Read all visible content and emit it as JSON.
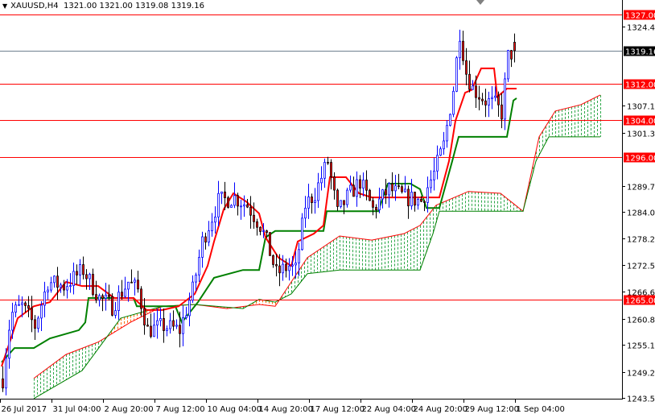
{
  "header": {
    "symbol": "XAUUSD,H4",
    "open": "1321.00",
    "high": "1321.00",
    "low": "1319.08",
    "close": "1319.16"
  },
  "colors": {
    "bull": "#0000ff",
    "bear_body": "#ff0000",
    "bear_wick": "#000000",
    "tenkan": "#ff0000",
    "kijun": "#008000",
    "span_a": "#ff0000",
    "span_b": "#008000",
    "hline": "#ff0000",
    "price_line": "#708090"
  },
  "chart_data": {
    "type": "candlestick",
    "title": "XAUUSD,H4",
    "ylim": [
      1242.0,
      1329.5
    ],
    "price_ticks": [
      "1324.40",
      "1307.15",
      "1301.30",
      "1289.75",
      "1284.05",
      "1278.20",
      "1272.50",
      "1266.65",
      "1260.80",
      "1255.10",
      "1249.25",
      "1243.55"
    ],
    "date_ticks": [
      "26 Jul 2017",
      "31 Jul 04:00",
      "2 Aug 20:00",
      "7 Aug 12:00",
      "10 Aug 04:00",
      "14 Aug 20:00",
      "17 Aug 12:00",
      "22 Aug 04:00",
      "24 Aug 20:00",
      "29 Aug 12:00",
      "1 Sep 04:00"
    ],
    "bars_per_date_tick": 16,
    "horizontal_levels": [
      {
        "label": "1327.00",
        "price": 1327.0
      },
      {
        "label": "1312.00",
        "price": 1312.0
      },
      {
        "label": "1304.00",
        "price": 1304.0
      },
      {
        "label": "1296.00",
        "price": 1296.0
      },
      {
        "label": "1265.00",
        "price": 1265.0
      }
    ],
    "current_price": {
      "label": "1319.16",
      "price": 1319.16
    },
    "close_path": [
      [
        0,
        1247.7
      ],
      [
        2.5,
        1261.8
      ],
      [
        6,
        1263.5
      ],
      [
        10,
        1259.2
      ],
      [
        14,
        1268.8
      ],
      [
        19,
        1267.9
      ],
      [
        25,
        1271.4
      ],
      [
        30,
        1265.3
      ],
      [
        34,
        1263.5
      ],
      [
        39,
        1268.8
      ],
      [
        42,
        1267.0
      ],
      [
        45,
        1258.3
      ],
      [
        50,
        1259.2
      ],
      [
        55,
        1258.3
      ],
      [
        59,
        1267.0
      ],
      [
        62,
        1277.6
      ],
      [
        67,
        1286.4
      ],
      [
        72,
        1287.2
      ],
      [
        76,
        1285.5
      ],
      [
        80,
        1281.1
      ],
      [
        82,
        1277.6
      ],
      [
        85,
        1270.6
      ],
      [
        89,
        1272.3
      ],
      [
        91,
        1271.4
      ],
      [
        94,
        1285.5
      ],
      [
        97,
        1288.1
      ],
      [
        101,
        1295.1
      ],
      [
        104,
        1283.7
      ],
      [
        107,
        1287.2
      ],
      [
        111,
        1290.7
      ],
      [
        115,
        1284.6
      ],
      [
        120,
        1289.0
      ],
      [
        125,
        1287.2
      ],
      [
        130,
        1286.4
      ],
      [
        134,
        1292.5
      ],
      [
        137,
        1298.6
      ],
      [
        140,
        1310.9
      ],
      [
        142,
        1323.2
      ],
      [
        144,
        1314.4
      ],
      [
        146,
        1310.9
      ],
      [
        150,
        1308.3
      ],
      [
        153,
        1307.4
      ],
      [
        155,
        1305.6
      ],
      [
        157,
        1317.9
      ],
      [
        159,
        1319.2
      ]
    ],
    "tenkan_sen": [
      [
        0,
        1250.4
      ],
      [
        5,
        1260.9
      ],
      [
        10,
        1263.5
      ],
      [
        15,
        1264.4
      ],
      [
        20,
        1268.8
      ],
      [
        25,
        1267.9
      ],
      [
        30,
        1267.9
      ],
      [
        35,
        1265.3
      ],
      [
        41,
        1265.3
      ],
      [
        45,
        1262.7
      ],
      [
        50,
        1262.7
      ],
      [
        55,
        1263.5
      ],
      [
        60,
        1266.2
      ],
      [
        64,
        1272.3
      ],
      [
        66,
        1277.6
      ],
      [
        69,
        1284.6
      ],
      [
        72,
        1288.1
      ],
      [
        76,
        1286.3
      ],
      [
        80,
        1283.7
      ],
      [
        82,
        1278.5
      ],
      [
        86,
        1274.1
      ],
      [
        90,
        1272.3
      ],
      [
        92,
        1277.6
      ],
      [
        97,
        1279.3
      ],
      [
        100,
        1281.1
      ],
      [
        102,
        1291.6
      ],
      [
        107,
        1291.6
      ],
      [
        111,
        1288.1
      ],
      [
        115,
        1287.2
      ],
      [
        136,
        1287.2
      ],
      [
        139,
        1295.1
      ],
      [
        141,
        1303.9
      ],
      [
        144,
        1310.0
      ],
      [
        146,
        1310.6
      ],
      [
        149,
        1315.3
      ],
      [
        153,
        1315.3
      ],
      [
        154,
        1309.1
      ],
      [
        157,
        1310.9
      ],
      [
        160,
        1310.9
      ]
    ],
    "kijun_sen": [
      [
        0,
        1251.3
      ],
      [
        4,
        1254.4
      ],
      [
        10,
        1254.4
      ],
      [
        15,
        1256.5
      ],
      [
        24,
        1258.3
      ],
      [
        26,
        1260.0
      ],
      [
        27,
        1265.3
      ],
      [
        41,
        1265.3
      ],
      [
        42,
        1263.5
      ],
      [
        54,
        1263.5
      ],
      [
        56,
        1260.0
      ],
      [
        61,
        1264.4
      ],
      [
        66,
        1269.7
      ],
      [
        75,
        1271.4
      ],
      [
        80,
        1271.4
      ],
      [
        82,
        1278.5
      ],
      [
        85,
        1279.9
      ],
      [
        100,
        1279.9
      ],
      [
        101,
        1284.2
      ],
      [
        105,
        1284.2
      ],
      [
        117,
        1284.2
      ],
      [
        120,
        1290.2
      ],
      [
        127,
        1290.2
      ],
      [
        130,
        1289.0
      ],
      [
        132,
        1284.9
      ],
      [
        136,
        1284.9
      ],
      [
        140,
        1295.1
      ],
      [
        142,
        1300.4
      ],
      [
        157,
        1300.4
      ],
      [
        159,
        1308.3
      ],
      [
        160,
        1308.8
      ]
    ],
    "senkou_span_a": [
      [
        10,
        1247.8
      ],
      [
        20,
        1253.0
      ],
      [
        30,
        1255.7
      ],
      [
        40,
        1260.0
      ],
      [
        50,
        1263.5
      ],
      [
        60,
        1263.9
      ],
      [
        70,
        1263.0
      ],
      [
        80,
        1263.9
      ],
      [
        85,
        1263.5
      ],
      [
        90,
        1268.8
      ],
      [
        95,
        1274.1
      ],
      [
        105,
        1278.8
      ],
      [
        115,
        1277.9
      ],
      [
        125,
        1279.3
      ],
      [
        130,
        1281.1
      ],
      [
        135,
        1285.5
      ],
      [
        145,
        1288.5
      ],
      [
        155,
        1288.1
      ],
      [
        162,
        1284.2
      ],
      [
        167,
        1300.4
      ],
      [
        172,
        1306.0
      ],
      [
        180,
        1307.4
      ],
      [
        186,
        1309.5
      ]
    ],
    "senkou_span_b": [
      [
        10,
        1243.4
      ],
      [
        25,
        1249.5
      ],
      [
        37,
        1260.9
      ],
      [
        50,
        1263.5
      ],
      [
        60,
        1263.9
      ],
      [
        75,
        1263.0
      ],
      [
        80,
        1265.0
      ],
      [
        85,
        1264.4
      ],
      [
        90,
        1266.2
      ],
      [
        95,
        1270.6
      ],
      [
        105,
        1271.4
      ],
      [
        130,
        1271.4
      ],
      [
        134,
        1279.3
      ],
      [
        136,
        1284.2
      ],
      [
        162,
        1284.2
      ],
      [
        166,
        1295.1
      ],
      [
        170,
        1300.4
      ],
      [
        186,
        1300.4
      ]
    ]
  }
}
